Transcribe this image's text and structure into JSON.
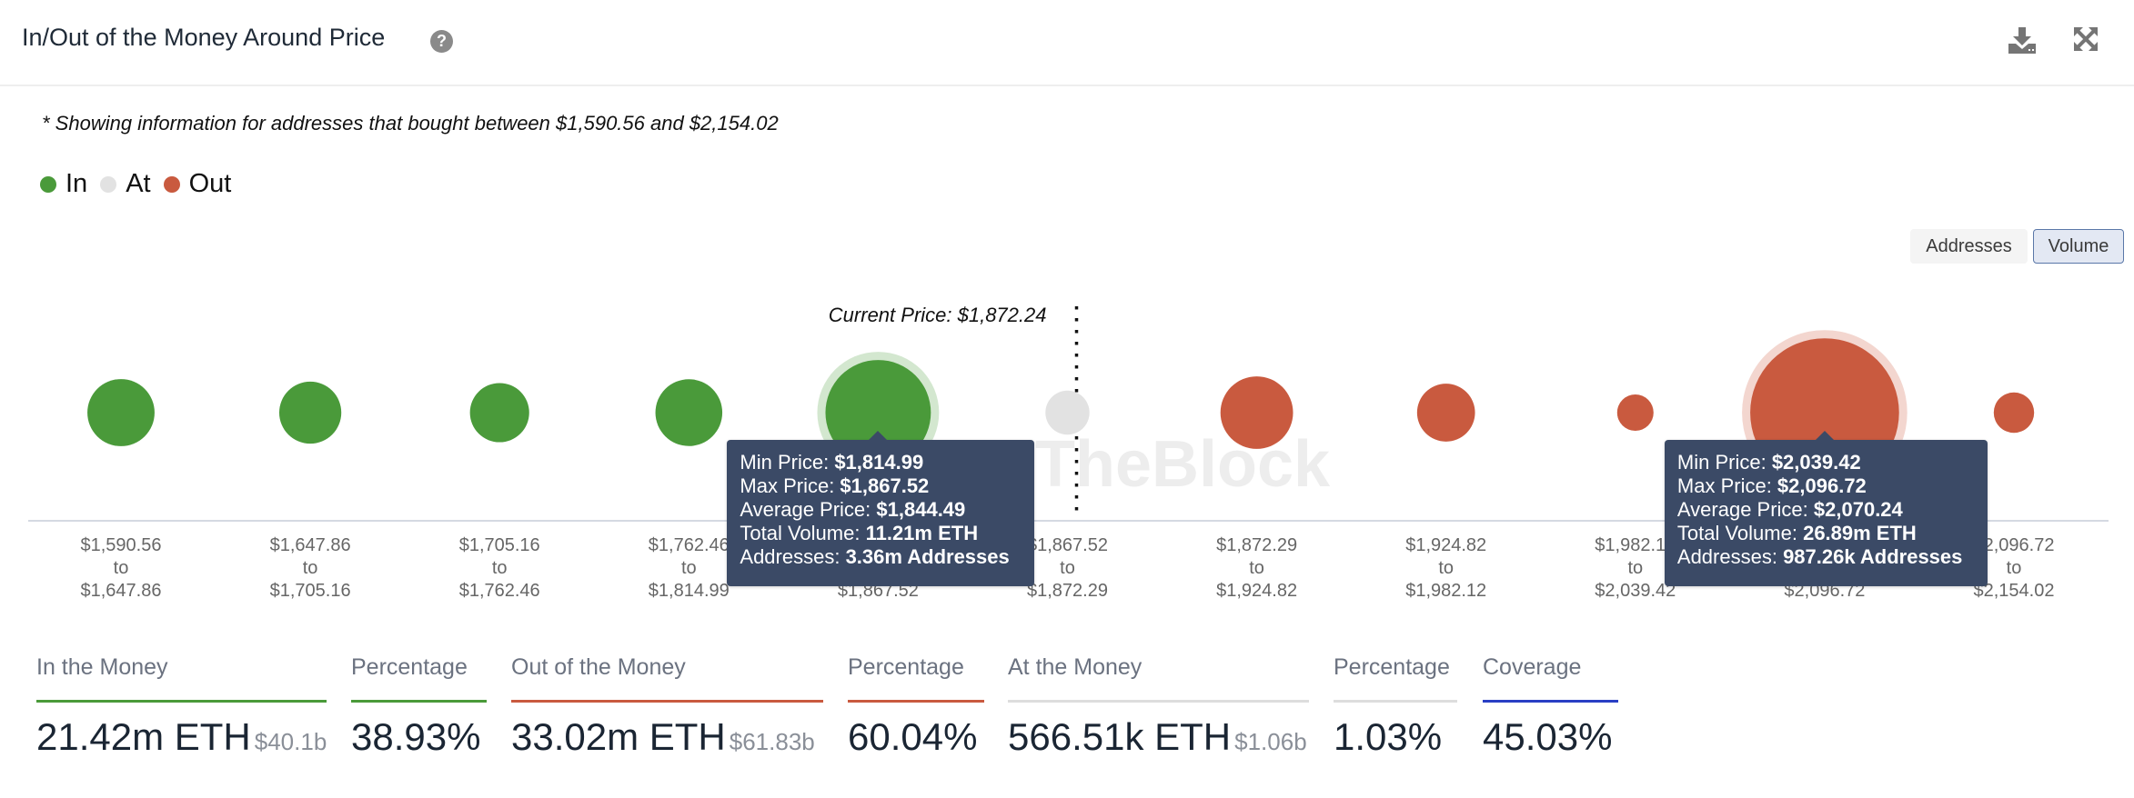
{
  "header": {
    "title": "In/Out of the Money Around Price",
    "help_icon": "question-circle-icon",
    "download_icon": "download-icon",
    "expand_icon": "expand-icon"
  },
  "subtitle": "* Showing information for addresses that bought between $1,590.56 and $2,154.02",
  "legend": [
    {
      "label": "In",
      "color": "#4a9a3a"
    },
    {
      "label": "At",
      "color": "#e2e2e2"
    },
    {
      "label": "Out",
      "color": "#c95a3f"
    }
  ],
  "toggle": {
    "options": [
      "Addresses",
      "Volume"
    ],
    "selected": "Volume"
  },
  "colors": {
    "in": "#4a9a3a",
    "in_halo": "#d3e7cf",
    "at": "#e2e2e2",
    "out": "#c95a3f",
    "out_halo": "#f3d6cf",
    "tooltip_bg": "#3b4a66",
    "coverage": "#2a3fc4"
  },
  "chart_data": {
    "type": "scatter",
    "title": "In/Out of the Money Around Price",
    "current_price_label": "Current Price: $1,872.24",
    "current_price": 1872.24,
    "watermark": "TheBlock",
    "size_metric": "Volume (ETH, millions; approximate except where shown in tooltips)",
    "buckets": [
      {
        "min": "$1,590.56",
        "max": "$1,647.86",
        "status": "in",
        "volume_m_eth": 3.0
      },
      {
        "min": "$1,647.86",
        "max": "$1,705.16",
        "status": "in",
        "volume_m_eth": 2.3
      },
      {
        "min": "$1,705.16",
        "max": "$1,762.46",
        "status": "in",
        "volume_m_eth": 1.95
      },
      {
        "min": "$1,762.46",
        "max": "$1,814.99",
        "status": "in",
        "volume_m_eth": 2.96
      },
      {
        "min": "$1,814.99",
        "max": "$1,867.52",
        "status": "in",
        "volume_m_eth": 11.21,
        "highlighted": true
      },
      {
        "min": "$1,867.52",
        "max": "$1,872.29",
        "status": "at",
        "volume_m_eth": 0.57
      },
      {
        "min": "$1,872.29",
        "max": "$1,924.82",
        "status": "out",
        "volume_m_eth": 3.85
      },
      {
        "min": "$1,924.82",
        "max": "$1,982.12",
        "status": "out",
        "volume_m_eth": 1.8
      },
      {
        "min": "$1,982.12",
        "max": "$2,039.42",
        "status": "out",
        "volume_m_eth": 0.12
      },
      {
        "min": "$2,039.42",
        "max": "$2,096.72",
        "status": "out",
        "volume_m_eth": 26.89,
        "highlighted": true
      },
      {
        "min": "$2,096.72",
        "max": "$2,154.02",
        "status": "out",
        "volume_m_eth": 0.36
      }
    ],
    "range_joiner": "to",
    "current_price_after_bucket": 5,
    "tooltips": [
      {
        "bucket": 4,
        "rows": [
          {
            "label": "Min Price: ",
            "value": "$1,814.99"
          },
          {
            "label": "Max Price: ",
            "value": "$1,867.52"
          },
          {
            "label": "Average Price: ",
            "value": "$1,844.49"
          },
          {
            "label": "Total Volume: ",
            "value": "11.21m ETH"
          },
          {
            "label": "Addresses: ",
            "value": "3.36m Addresses"
          }
        ]
      },
      {
        "bucket": 9,
        "rows": [
          {
            "label": "Min Price: ",
            "value": "$2,039.42"
          },
          {
            "label": "Max Price: ",
            "value": "$2,096.72"
          },
          {
            "label": "Average Price: ",
            "value": "$2,070.24"
          },
          {
            "label": "Total Volume: ",
            "value": "26.89m ETH"
          },
          {
            "label": "Addresses: ",
            "value": "987.26k Addresses"
          }
        ]
      }
    ]
  },
  "stats": [
    {
      "label": "In the Money",
      "value": "21.42m ETH",
      "sub": "$40.1b",
      "bar": "in"
    },
    {
      "label": "Percentage",
      "value": "38.93%",
      "sub": "",
      "bar": "in"
    },
    {
      "label": "Out of the Money",
      "value": "33.02m ETH",
      "sub": "$61.83b",
      "bar": "out"
    },
    {
      "label": "Percentage",
      "value": "60.04%",
      "sub": "",
      "bar": "out"
    },
    {
      "label": "At the Money",
      "value": "566.51k ETH",
      "sub": "$1.06b",
      "bar": "at"
    },
    {
      "label": "Percentage",
      "value": "1.03%",
      "sub": "",
      "bar": "at"
    },
    {
      "label": "Coverage",
      "value": "45.03%",
      "sub": "",
      "bar": "coverage"
    }
  ]
}
